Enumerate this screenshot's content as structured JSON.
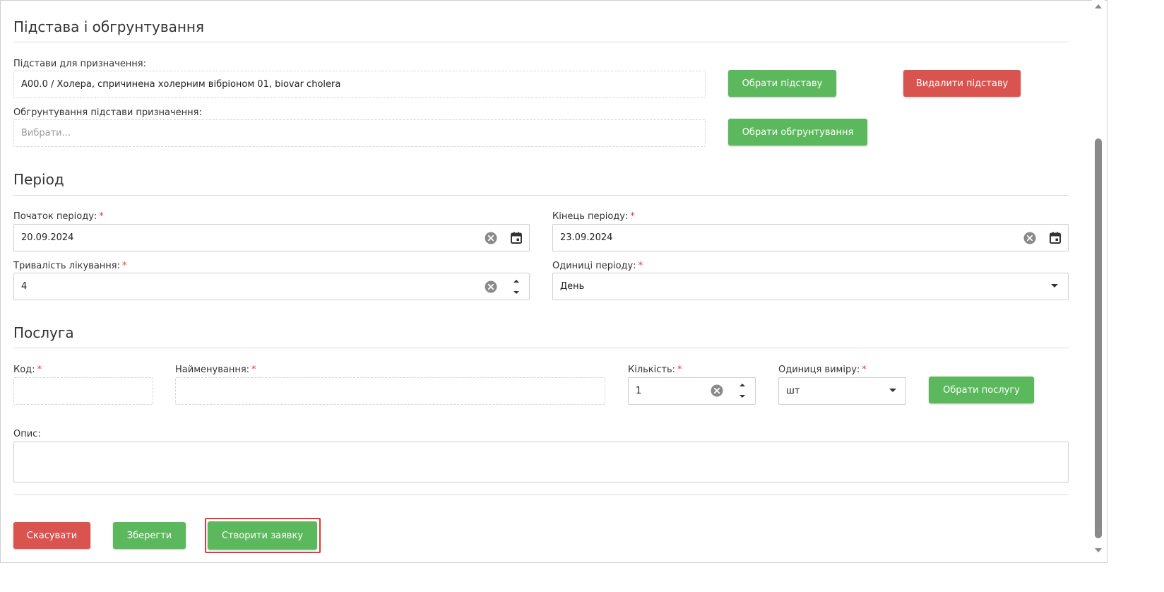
{
  "sections": {
    "basis_title": "Підстава і обгрунтування",
    "period_title": "Період",
    "service_title": "Послуга"
  },
  "basis": {
    "label": "Підстави для призначення:",
    "value": "A00.0 / Холера, спричинена холерним вібріоном 01, biovar cholera",
    "select_button": "Обрати підставу",
    "delete_button": "Видалити підставу",
    "justification_label": "Обгрунтування підстави призначення:",
    "justification_placeholder": "Вибрати...",
    "justification_button": "Обрати обгрунтування"
  },
  "period": {
    "start_label": "Початок періоду:",
    "start_value": "20.09.2024",
    "end_label": "Кінець періоду:",
    "end_value": "23.09.2024",
    "duration_label": "Тривалість лікування:",
    "duration_value": "4",
    "units_label": "Одиниці періоду:",
    "units_value": "День"
  },
  "service": {
    "code_label": "Код:",
    "name_label": "Найменування:",
    "quantity_label": "Кількість:",
    "quantity_value": "1",
    "measure_label": "Одиниця виміру:",
    "measure_value": "шт",
    "select_button": "Обрати послугу",
    "description_label": "Опис:"
  },
  "required_mark": "*",
  "actions": {
    "cancel": "Скасувати",
    "save": "Зберегти",
    "create_request": "Створити заявку"
  },
  "colors": {
    "green": "#5cb85c",
    "red": "#d9534f",
    "highlight": "#e03a3a"
  },
  "icons": {
    "clear": "clear-circle-icon",
    "calendar": "calendar-icon",
    "dropdown": "caret-down-icon",
    "spinner": "spinner-arrows-icon"
  }
}
